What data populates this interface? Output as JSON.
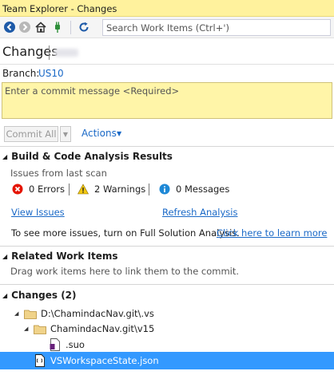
{
  "window": {
    "title": "Team Explorer - Changes"
  },
  "toolbar": {
    "search_placeholder": "Search Work Items (Ctrl+')"
  },
  "page": {
    "title": "Changes"
  },
  "branch": {
    "label": "Branch:",
    "value": "US10"
  },
  "commit": {
    "message_placeholder": "Enter a commit message <Required>",
    "commit_all_label": "Commit All",
    "actions_label": "Actions"
  },
  "build_section": {
    "title": "Build & Code Analysis Results",
    "subtitle": "Issues from last scan",
    "errors": "0 Errors",
    "warnings": "2 Warnings",
    "messages": "0 Messages",
    "view_issues": "View Issues",
    "refresh_analysis": "Refresh Analysis",
    "info_text": "To see more issues, turn on Full Solution Analysis.",
    "learn_more": "Click here to learn more"
  },
  "related_section": {
    "title": "Related Work Items",
    "hint": "Drag work items here to link them to the commit."
  },
  "changes_section": {
    "title": "Changes (2)",
    "tree": [
      {
        "label": "D:\\ChamindacNav.git\\.vs"
      },
      {
        "label": "ChamindacNav.git\\v15"
      },
      {
        "label": ".suo"
      },
      {
        "label": "VSWorkspaceState.json"
      }
    ]
  },
  "colors": {
    "title_bar": "#fff29d",
    "commit_box": "#fff5a8",
    "link": "#1a69c7",
    "selection": "#3399ff"
  }
}
